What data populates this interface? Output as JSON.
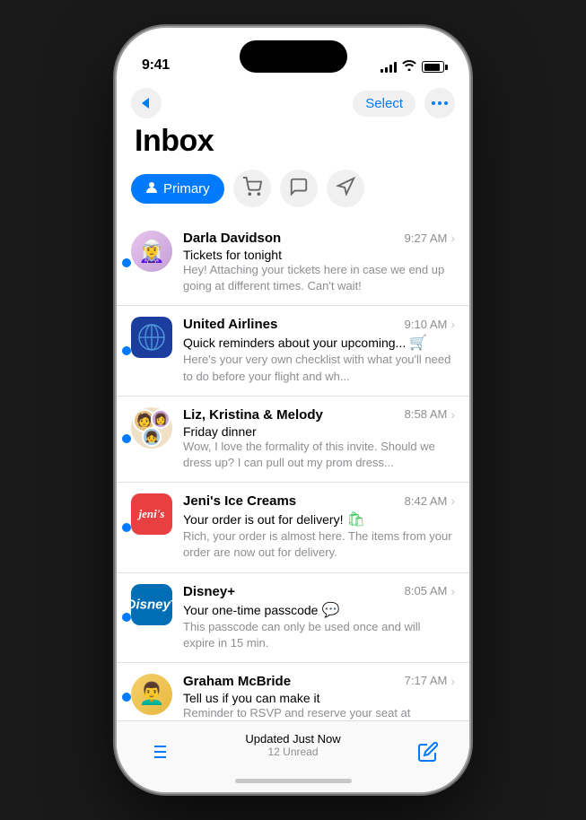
{
  "statusBar": {
    "time": "9:41"
  },
  "nav": {
    "selectLabel": "Select",
    "moreLabel": "···"
  },
  "inbox": {
    "title": "Inbox",
    "tabs": [
      {
        "id": "primary",
        "label": "Primary",
        "active": true
      },
      {
        "id": "shopping",
        "label": "Shopping",
        "active": false
      },
      {
        "id": "chat",
        "label": "Chat",
        "active": false
      },
      {
        "id": "promotions",
        "label": "Promotions",
        "active": false
      }
    ]
  },
  "emails": [
    {
      "id": 1,
      "sender": "Darla Davidson",
      "subject": "Tickets for tonight",
      "preview": "Hey! Attaching your tickets here in case we end up going at different times. Can't wait!",
      "time": "9:27 AM",
      "unread": true,
      "avatar": "darla",
      "hasShoppingIcon": false,
      "hasMessageIcon": false
    },
    {
      "id": 2,
      "sender": "United Airlines",
      "subject": "Quick reminders about your upcoming...",
      "preview": "Here's your very own checklist with what you'll need to do before your flight and wh...",
      "time": "9:10 AM",
      "unread": true,
      "avatar": "united",
      "hasShoppingIcon": true,
      "hasMessageIcon": false
    },
    {
      "id": 3,
      "sender": "Liz, Kristina & Melody",
      "subject": "Friday dinner",
      "preview": "Wow, I love the formality of this invite. Should we dress up? I can pull out my prom dress...",
      "time": "8:58 AM",
      "unread": true,
      "avatar": "group",
      "hasShoppingIcon": false,
      "hasMessageIcon": false
    },
    {
      "id": 4,
      "sender": "Jeni's Ice Creams",
      "subject": "Your order is out for delivery!",
      "preview": "Rich, your order is almost here. The items from your order are now out for delivery.",
      "time": "8:42 AM",
      "unread": true,
      "avatar": "jenis",
      "hasShoppingIcon": true,
      "hasMessageIcon": false
    },
    {
      "id": 5,
      "sender": "Disney+",
      "subject": "Your one-time passcode",
      "preview": "This passcode can only be used once and will expire in 15 min.",
      "time": "8:05 AM",
      "unread": true,
      "avatar": "disney",
      "hasShoppingIcon": false,
      "hasMessageIcon": true
    },
    {
      "id": 6,
      "sender": "Graham McBride",
      "subject": "Tell us if you can make it",
      "preview": "Reminder to RSVP and reserve your seat at",
      "time": "7:17 AM",
      "unread": true,
      "avatar": "graham",
      "hasShoppingIcon": false,
      "hasMessageIcon": false
    }
  ],
  "bottomBar": {
    "updatedLabel": "Updated Just Now",
    "unreadLabel": "12 Unread"
  },
  "colors": {
    "blue": "#007AFF",
    "green": "#34c759",
    "gray": "#8e8e93"
  }
}
